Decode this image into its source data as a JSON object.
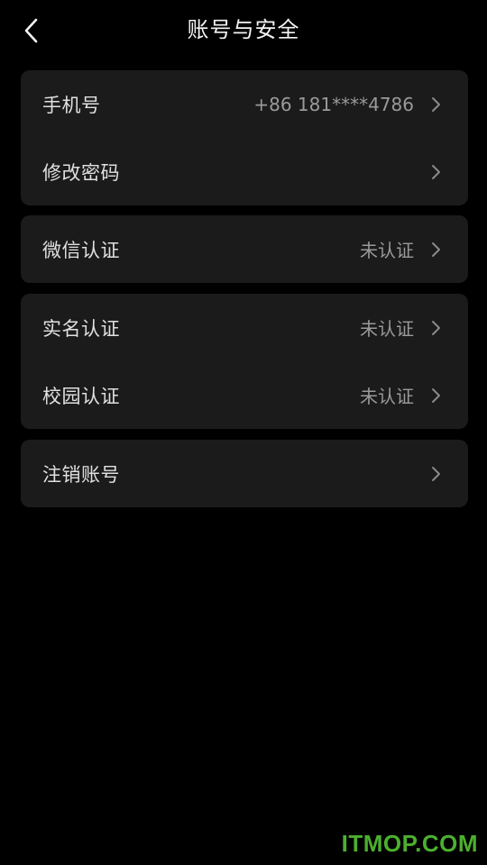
{
  "header": {
    "back_icon": "chevron-left-icon",
    "title": "账号与安全"
  },
  "groups": [
    {
      "items": [
        {
          "label": "手机号",
          "value": "+86 181****4786",
          "icon": "chevron-right-icon"
        },
        {
          "label": "修改密码",
          "value": "",
          "icon": "chevron-right-icon"
        }
      ]
    },
    {
      "items": [
        {
          "label": "微信认证",
          "value": "未认证",
          "icon": "chevron-right-icon"
        }
      ]
    },
    {
      "items": [
        {
          "label": "实名认证",
          "value": "未认证",
          "icon": "chevron-right-icon"
        },
        {
          "label": "校园认证",
          "value": "未认证",
          "icon": "chevron-right-icon"
        }
      ]
    },
    {
      "items": [
        {
          "label": "注销账号",
          "value": "",
          "icon": "chevron-right-icon"
        }
      ]
    }
  ],
  "watermark": "ITMOP.COM",
  "colors": {
    "background": "#000000",
    "card": "#1b1b1b",
    "label": "#e0e0e0",
    "value": "#9a9a9a",
    "watermark": "#4caf2f"
  }
}
